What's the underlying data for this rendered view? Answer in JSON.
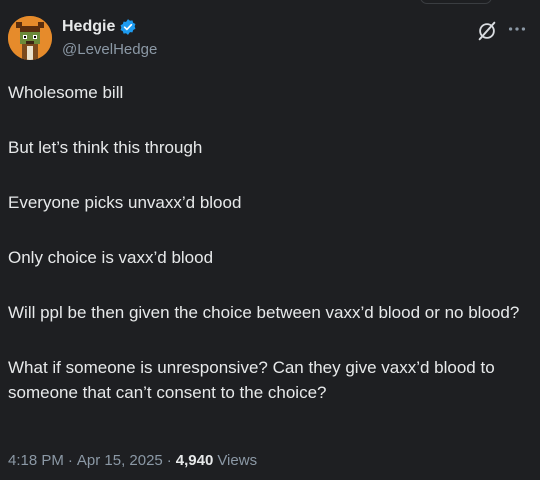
{
  "author": {
    "display_name": "Hedgie",
    "handle": "@LevelHedge",
    "avatar_icon": "pixel-art-hedgehog-avatar",
    "verified": true,
    "verified_color": "#1d9bf0"
  },
  "tweet": {
    "paragraphs": [
      "Wholesome bill",
      "But let’s think this through",
      "Everyone picks unvaxx’d blood",
      "Only choice is vaxx’d blood",
      "Will ppl be then given the choice between vaxx’d blood or no blood?",
      "What if someone is unresponsive? Can they give vaxx’d blood to someone that can’t consent to the choice?"
    ]
  },
  "meta": {
    "time": "4:18 PM",
    "separator": "·",
    "date": "Apr 15, 2025",
    "separator2": "·",
    "views_count": "4,940",
    "views_label": "Views"
  },
  "icons": {
    "grok": "grok-icon",
    "more": "more-options-icon"
  },
  "colors": {
    "background": "#1e1f22",
    "text": "#e7e9ea",
    "secondary_text": "#8b98a5",
    "accent": "#1d9bf0"
  }
}
